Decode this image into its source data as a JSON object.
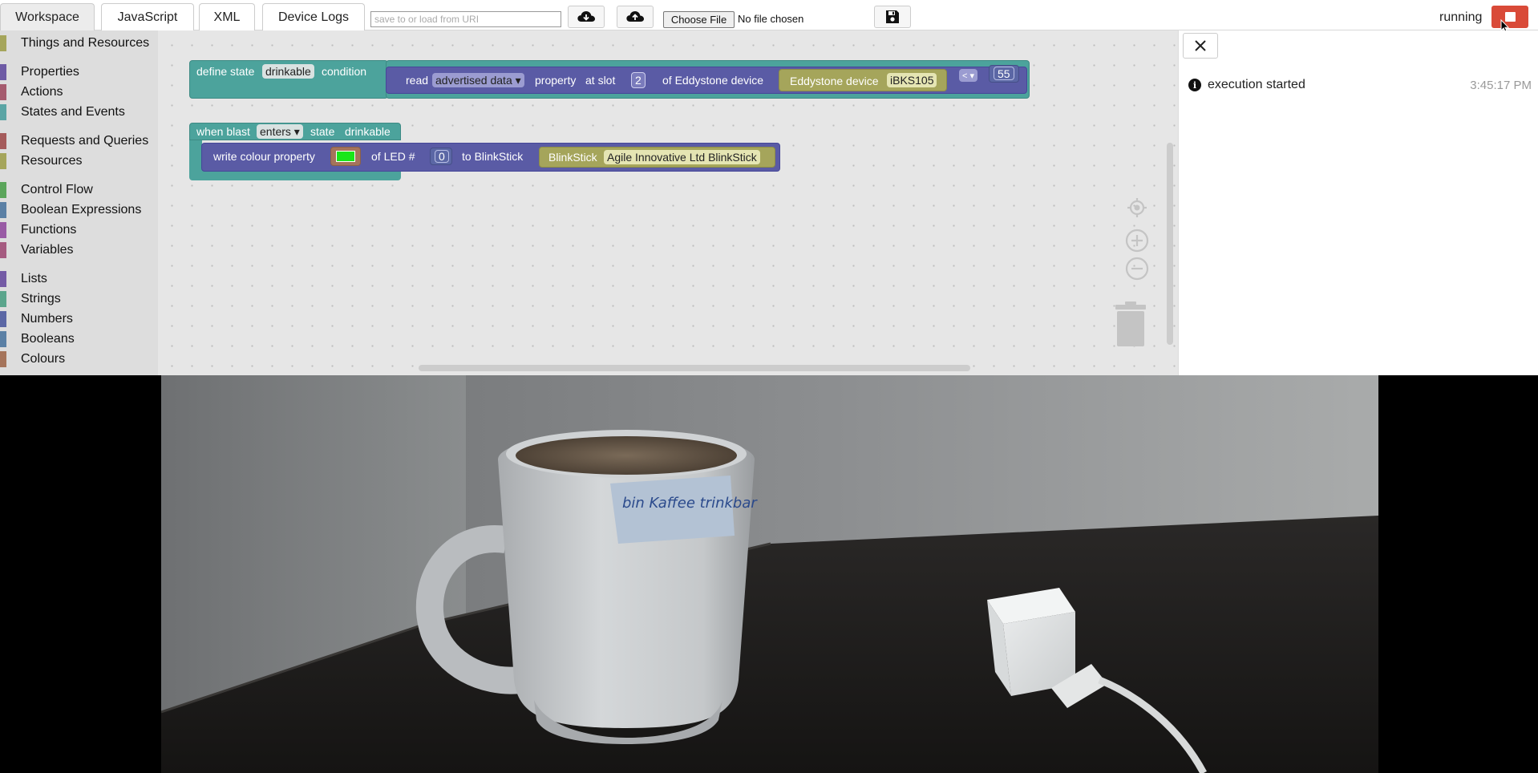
{
  "tabs": [
    {
      "label": "Workspace",
      "active": true
    },
    {
      "label": "JavaScript",
      "active": false
    },
    {
      "label": "XML",
      "active": false
    },
    {
      "label": "Device Logs",
      "active": false
    }
  ],
  "toolbar": {
    "uri_placeholder": "save to or load from URI",
    "load_icon": "cloud-download-icon",
    "upload_icon": "cloud-upload-icon",
    "save_icon": "floppy-disk-icon",
    "choose_file_label": "Choose File",
    "file_status": "No file chosen",
    "run_status": "running",
    "stop_color": "#d94a38"
  },
  "toolbox": {
    "categories": [
      {
        "label": "Things and Resources",
        "color": "#a5a55b"
      },
      {
        "label": "Properties",
        "color": "#6e5ba5"
      },
      {
        "label": "Actions",
        "color": "#a55b6e"
      },
      {
        "label": "States and Events",
        "color": "#5ba5a5"
      },
      {
        "label": "Requests and Queries",
        "color": "#a55b5b"
      },
      {
        "label": "Resources",
        "color": "#a5a55b"
      },
      {
        "label": "Control Flow",
        "color": "#5ba55b"
      },
      {
        "label": "Boolean Expressions",
        "color": "#5b80a5"
      },
      {
        "label": "Functions",
        "color": "#995ba5"
      },
      {
        "label": "Variables",
        "color": "#a55b80"
      },
      {
        "label": "Lists",
        "color": "#745ba5"
      },
      {
        "label": "Strings",
        "color": "#5ba58c"
      },
      {
        "label": "Numbers",
        "color": "#5b67a5"
      },
      {
        "label": "Booleans",
        "color": "#5b80a5"
      },
      {
        "label": "Colours",
        "color": "#a5745b"
      }
    ]
  },
  "workspace": {
    "block1": {
      "define_state": "define state",
      "state_name": "drinkable",
      "condition": "condition",
      "read": "read",
      "property_name": "advertised data ▾",
      "property": "property",
      "at_slot": "at slot",
      "slot_value": "2",
      "of_device": "of Eddystone device",
      "device_type": "Eddystone device",
      "device_name": "iBKS105",
      "operator": "< ▾",
      "compare_value": "55"
    },
    "block2": {
      "when_blast": "when blast",
      "transition": "enters ▾",
      "state": "state",
      "state_name": "drinkable",
      "write_colour": "write colour property",
      "colour_value": "#19e619",
      "of_led": "of LED #",
      "led_index": "0",
      "to_blinkstick": "to BlinkStick",
      "device_type": "BlinkStick",
      "device_name": "Agile Innovative Ltd BlinkStick"
    },
    "controls": {
      "recenter_icon": "target-icon",
      "zoom_in_icon": "zoom-in-icon",
      "zoom_out_icon": "zoom-out-icon",
      "trash_icon": "trash-icon"
    }
  },
  "log": {
    "close_icon": "close-icon",
    "entries": [
      {
        "icon": "info-icon",
        "message": "execution started",
        "time": "3:45:17 PM"
      }
    ]
  },
  "camera": {
    "mug_label_text": "bin Kaffee trinkbar"
  }
}
